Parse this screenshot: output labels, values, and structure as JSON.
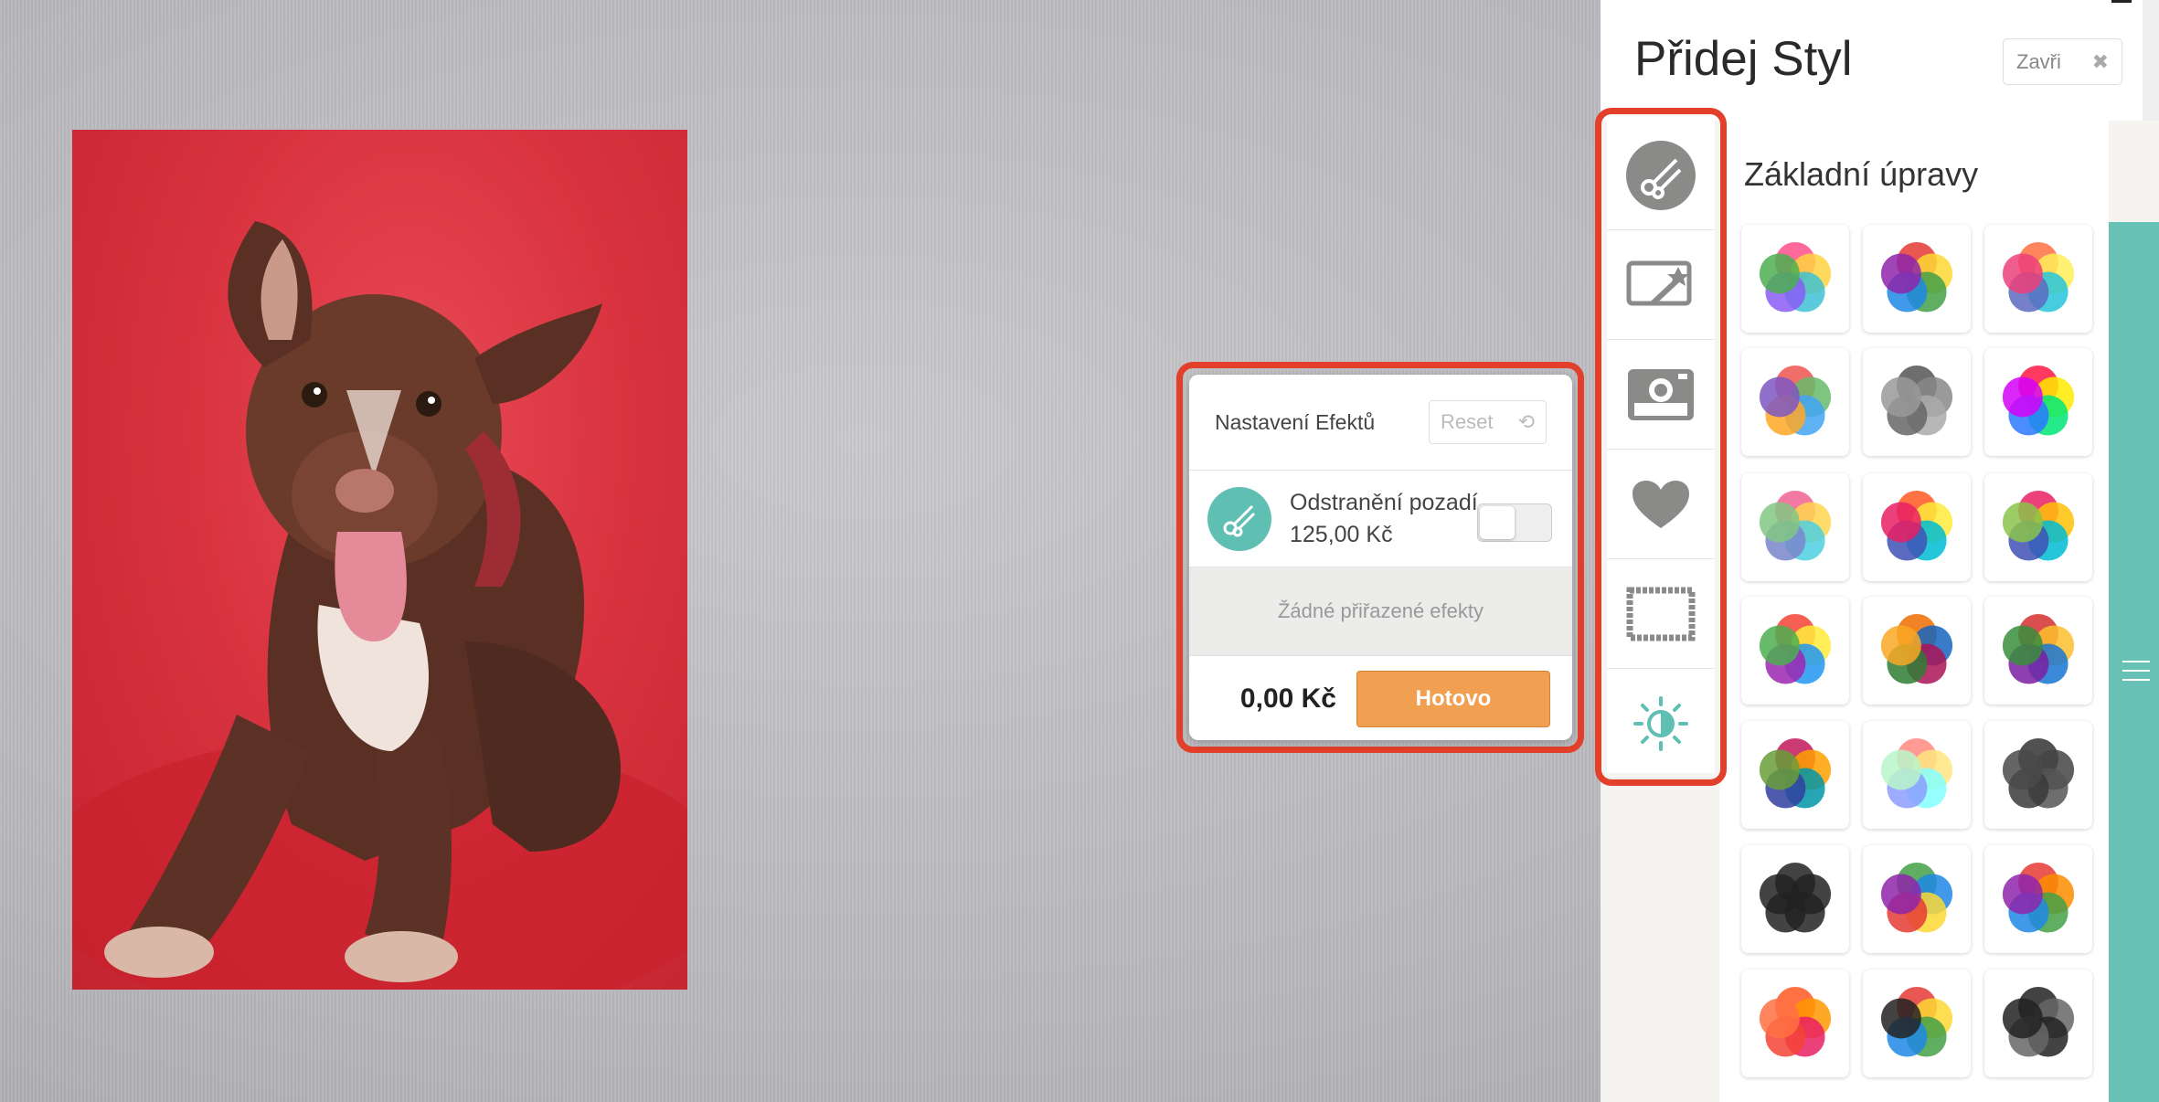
{
  "panel": {
    "title": "Přidej Styl",
    "close_label": "Zavři",
    "section_title": "Základní úpravy",
    "category_icons": [
      "scissors-icon",
      "magic-wand-icon",
      "polaroid-camera-icon",
      "heart-icon",
      "stamp-frame-icon",
      "contrast-sun-icon"
    ],
    "selected_category": "contrast-sun-icon"
  },
  "effects": {
    "title": "Nastavení Efektů",
    "reset_label": "Reset",
    "item_name": "Odstranění pozadí",
    "item_price": "125,00 Kč",
    "item_enabled": false,
    "empty_text": "Žádné přiřazené efekty",
    "total": "0,00 Kč",
    "done_label": "Hotovo"
  },
  "colors": {
    "accent_teal": "#67c2b5",
    "done_orange": "#f0a050",
    "highlight_red": "#e2402a",
    "photo_background": "#d93340"
  },
  "style_tiles": [
    "rainbow-flower-icon",
    "vivid-flower-icon",
    "bright-flower-icon",
    "cool-flower-icon",
    "grayscale-flower-icon",
    "saturated-flower-icon",
    "soft-flower-icon",
    "warm-flower-icon",
    "pixel-flower-icon",
    "dots-flower-icon",
    "mosaic-flower-icon",
    "hexagon-flower-icon",
    "stripes-flower-icon",
    "blur-flower-icon",
    "dark-flower-icon",
    "swirl-flower-icon",
    "kaleidoscope-flower-icon",
    "spiral-flower-icon",
    "orange-flower-icon",
    "halftone-flower-icon",
    "line-flower-icon"
  ]
}
